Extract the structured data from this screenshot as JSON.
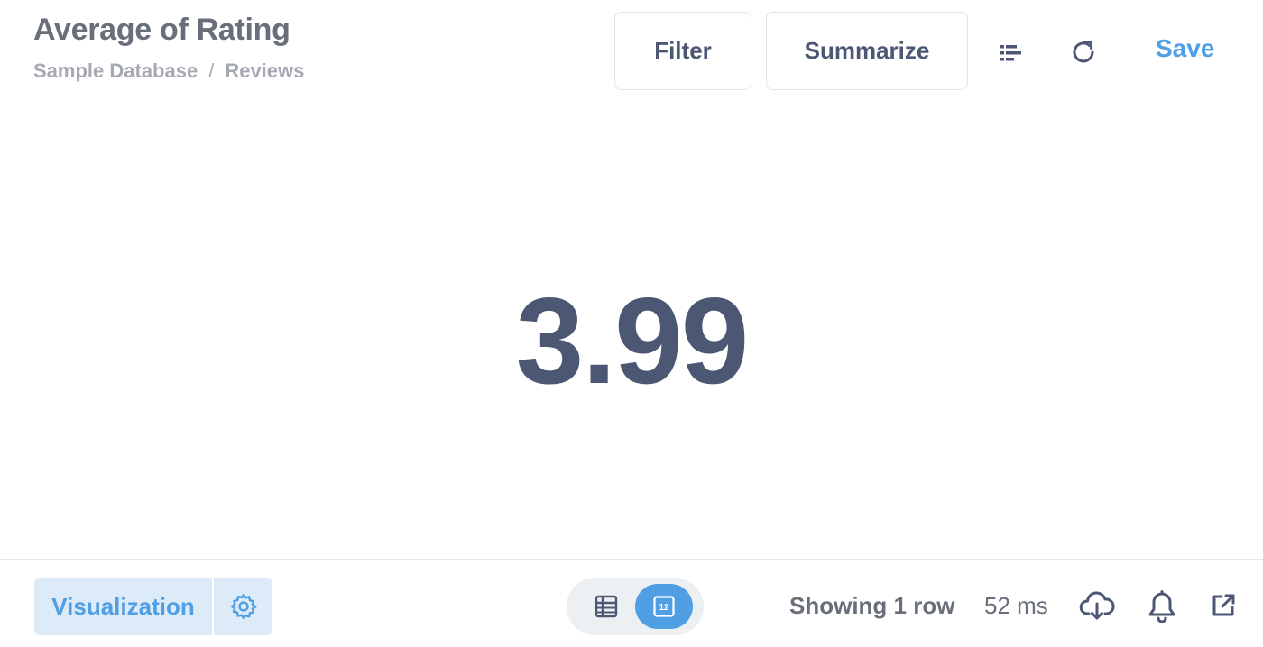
{
  "header": {
    "title": "Average of Rating",
    "breadcrumb": [
      "Sample Database",
      "Reviews"
    ],
    "breadcrumb_separator": "/",
    "filter_label": "Filter",
    "summarize_label": "Summarize",
    "save_label": "Save"
  },
  "main": {
    "scalar_value": "3.99"
  },
  "footer": {
    "visualization_label": "Visualization",
    "row_count": "Showing 1 row",
    "timing": "52 ms"
  },
  "icons": {
    "notebook": "notebook-icon",
    "refresh": "refresh-icon",
    "settings": "gear-icon",
    "table_view": "table-icon",
    "scalar_view": "number-icon",
    "download": "cloud-download-icon",
    "alert": "bell-icon",
    "share": "external-link-icon"
  },
  "colors": {
    "brand": "#509ee3",
    "text_dark": "#4c5773",
    "text_medium": "#696e7b",
    "text_light": "#a5a9b2"
  }
}
